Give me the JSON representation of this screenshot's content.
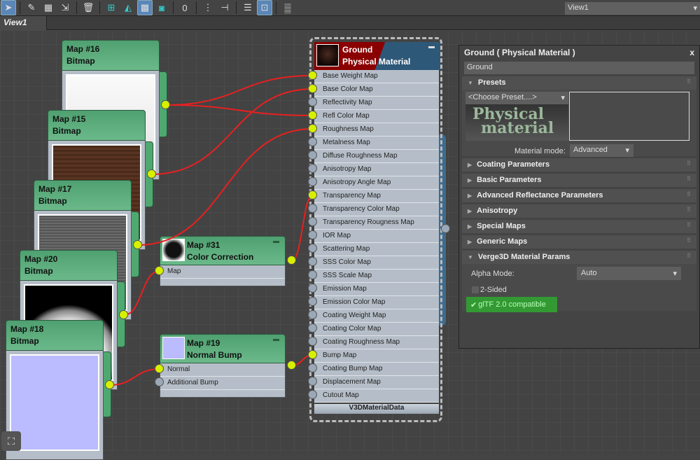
{
  "toolbar": {
    "icons": [
      "select-arrow-icon",
      "eyedropper-icon",
      "material-grid-icon",
      "assign-icon",
      "delete-icon",
      "layout-icon",
      "layout-children-icon",
      "background-checker-icon",
      "checker-icon",
      "zero-icon",
      "move-children-icon",
      "hide-unused-icon",
      "list-icon",
      "show-window-icon",
      "render-map-icon"
    ],
    "view_select": "View1",
    "dropdown_arrow": "▾"
  },
  "tabs": {
    "active": "View1"
  },
  "nodes": {
    "map16": {
      "title": "Map #16",
      "type": "Bitmap"
    },
    "map15": {
      "title": "Map #15",
      "type": "Bitmap"
    },
    "map17": {
      "title": "Map #17",
      "type": "Bitmap"
    },
    "map20": {
      "title": "Map #20",
      "type": "Bitmap"
    },
    "map18": {
      "title": "Map #18",
      "type": "Bitmap"
    },
    "map31": {
      "title": "Map #31",
      "type": "Color Correction",
      "inputs": [
        "Map"
      ]
    },
    "map19": {
      "title": "Map #19",
      "type": "Normal Bump",
      "inputs": [
        "Normal",
        "Additional Bump"
      ]
    }
  },
  "material": {
    "name": "Ground",
    "type": "Physical Material",
    "footer": "V3DMaterialData",
    "slots": [
      {
        "label": "Base Weight Map",
        "connected": true
      },
      {
        "label": "Base Color Map",
        "connected": true
      },
      {
        "label": "Reflectivity Map",
        "connected": false
      },
      {
        "label": "Refl Color Map",
        "connected": true
      },
      {
        "label": "Roughness Map",
        "connected": true
      },
      {
        "label": "Metalness Map",
        "connected": false
      },
      {
        "label": "Diffuse Roughness Map",
        "connected": false
      },
      {
        "label": "Anisotropy Map",
        "connected": false
      },
      {
        "label": "Anisotropy Angle Map",
        "connected": false
      },
      {
        "label": "Transparency Map",
        "connected": true
      },
      {
        "label": "Transparency Color Map",
        "connected": false
      },
      {
        "label": "Transparency Rougness Map",
        "connected": false
      },
      {
        "label": "IOR Map",
        "connected": false
      },
      {
        "label": "Scattering Map",
        "connected": false
      },
      {
        "label": "SSS Color Map",
        "connected": false
      },
      {
        "label": "SSS Scale Map",
        "connected": false
      },
      {
        "label": "Emission Map",
        "connected": false
      },
      {
        "label": "Emission Color Map",
        "connected": false
      },
      {
        "label": "Coating Weight Map",
        "connected": false
      },
      {
        "label": "Coating Color Map",
        "connected": false
      },
      {
        "label": "Coating Roughness Map",
        "connected": false
      },
      {
        "label": "Bump Map",
        "connected": true
      },
      {
        "label": "Coating Bump Map",
        "connected": false
      },
      {
        "label": "Displacement Map",
        "connected": false
      },
      {
        "label": "Cutout Map",
        "connected": false
      }
    ]
  },
  "panel": {
    "title": "Ground  ( Physical Material )",
    "close": "x",
    "name_value": "Ground",
    "presets": {
      "label": "Presets",
      "choose": "<Choose Preset....>",
      "logo_line1": "Physical",
      "logo_line2": "material",
      "mode_label": "Material mode:",
      "mode_value": "Advanced"
    },
    "rollouts": [
      "Coating Parameters",
      "Basic Parameters",
      "Advanced Reflectance Parameters",
      "Anisotropy",
      "Special Maps",
      "Generic Maps"
    ],
    "verge": {
      "label": "Verge3D Material Params",
      "alpha_label": "Alpha Mode:",
      "alpha_value": "Auto",
      "two_sided": "2-Sided",
      "two_sided_checked": false,
      "gltf": "glTF 2.0 compatible",
      "gltf_checked": true
    }
  },
  "colors": {
    "wire": "#e82020",
    "socket_on": "#d6f000",
    "socket_off": "#9aa8b8",
    "node_green": "#5aa87a",
    "mat_red": "#8a0000",
    "mat_blue": "#2e5878",
    "gltf_green": "#339933"
  }
}
